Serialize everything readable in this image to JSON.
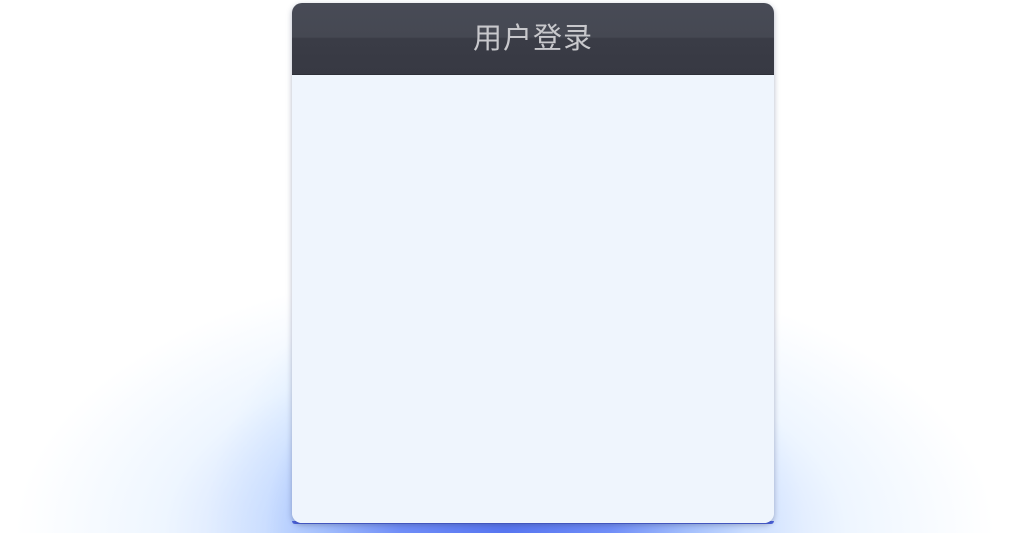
{
  "login": {
    "title": "用户登录"
  },
  "colors": {
    "header_bg": "#3a3c46",
    "panel_bg": "#eff5fd",
    "title_text": "#c8c8cc",
    "glow": "#4c63e0"
  }
}
